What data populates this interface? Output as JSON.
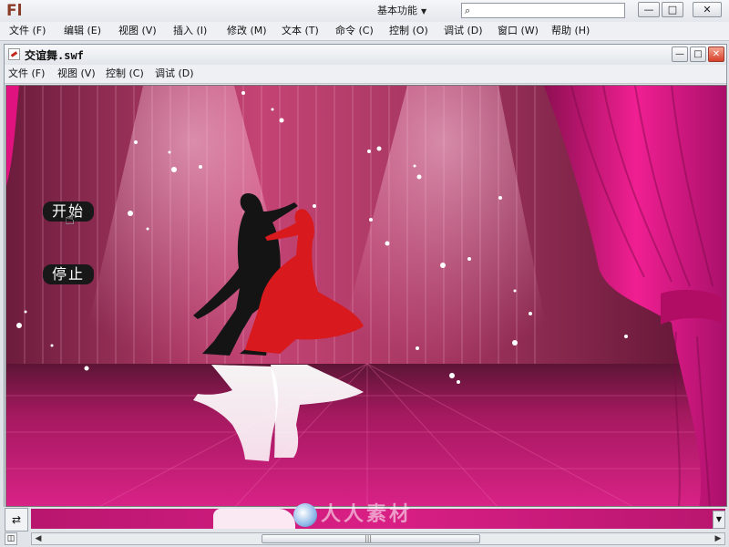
{
  "app": {
    "logo": "Fl",
    "workspace_label": "基本功能",
    "search_icon": "search-icon",
    "search_placeholder": "",
    "window_buttons": [
      "minimize-icon",
      "maximize-icon",
      "close-icon"
    ]
  },
  "menu": {
    "items": [
      "文件 (F)",
      "编辑 (E)",
      "视图 (V)",
      "插入 (I)",
      "修改 (M)",
      "文本 (T)",
      "命令 (C)",
      "控制 (O)",
      "调试 (D)",
      "窗口 (W)",
      "帮助 (H)"
    ]
  },
  "doc": {
    "title": "交谊舞.swf",
    "menu": [
      "文件 (F)",
      "视图 (V)",
      "控制 (C)",
      "调试 (D)"
    ]
  },
  "stage": {
    "start_label": "开始",
    "stop_label": "停止",
    "cursor_icon": "hand-cursor-icon",
    "colors": {
      "curtain": "#e0127f",
      "floor": "#c81a78",
      "backdrop": "#c44474",
      "silhouette_man": "#141414",
      "silhouette_woman": "#d8191d"
    }
  },
  "watermark": "人人素材"
}
